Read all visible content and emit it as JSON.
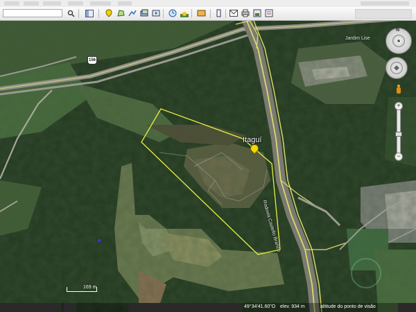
{
  "toolbar": {
    "search_placeholder": "",
    "icons": [
      "search-icon",
      "sidebar-icon",
      "placemark-icon",
      "polygon-icon",
      "path-icon",
      "overlay-icon",
      "tour-icon",
      "historical-imagery-icon",
      "sunlight-icon",
      "planets-icon",
      "ruler-icon",
      "email-icon",
      "print-icon",
      "save-image-icon",
      "maps-icon"
    ]
  },
  "map": {
    "place_label": "Itaguí",
    "neighborhood_label": "Jardim Lise",
    "road_label": "Rodovia Castello Branco",
    "highway_shield": "156",
    "scale_label": "169 m",
    "boundary_color": "#e8f040",
    "road_color": "#d9d96a"
  },
  "status": {
    "coords": "49°34'41.60\"O",
    "elev": "elev.  934 m",
    "alt": "altitude do ponto de visão"
  },
  "nav": {
    "north": "N",
    "zoom_in": "+",
    "zoom_out": "−",
    "zoom_level": 0.45
  }
}
